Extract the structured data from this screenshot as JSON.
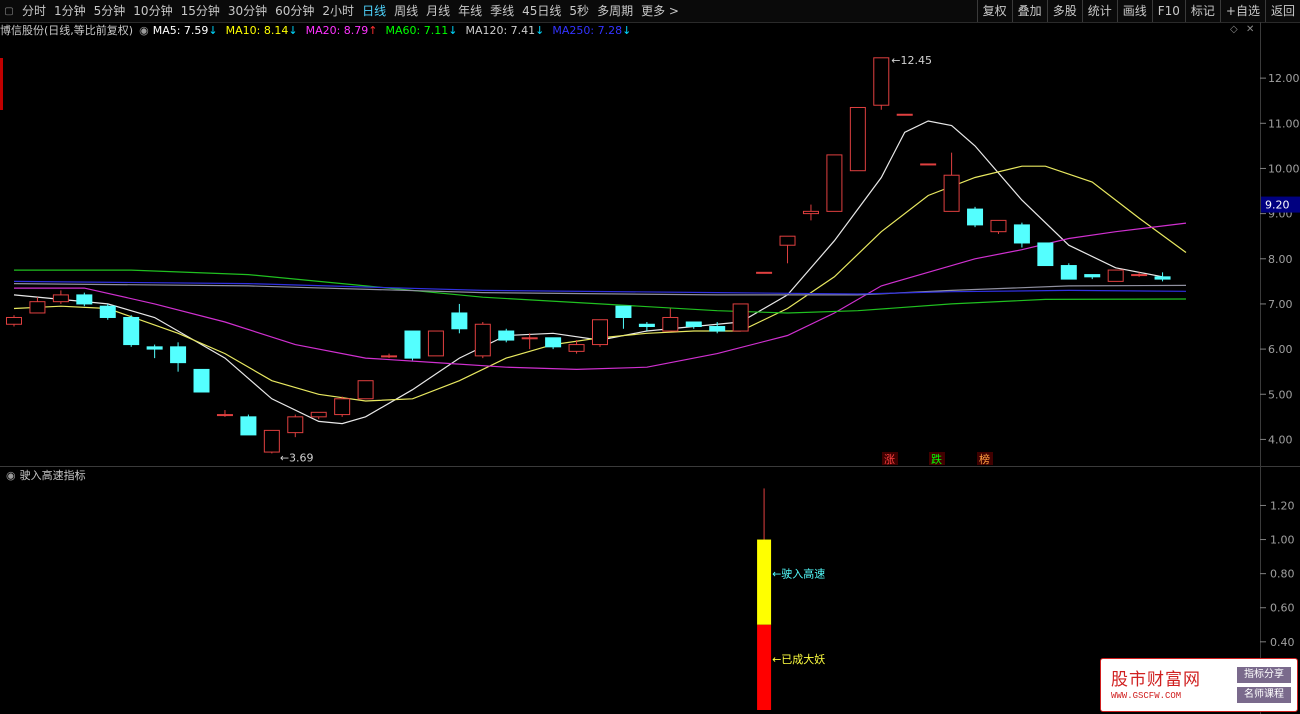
{
  "toolbar": {
    "periods": [
      "分时",
      "1分钟",
      "5分钟",
      "10分钟",
      "15分钟",
      "30分钟",
      "60分钟",
      "2小时",
      "日线",
      "周线",
      "月线",
      "年线",
      "季线",
      "45日线",
      "5秒",
      "多周期",
      "更多 >"
    ],
    "active_period": "日线",
    "right_buttons": [
      "复权",
      "叠加",
      "多股",
      "统计",
      "画线",
      "F10",
      "标记",
      "+自选",
      "返回"
    ]
  },
  "stock": {
    "title": "博信股份(日线,等比前复权)",
    "ma": [
      {
        "label": "MA5: 7.59",
        "arrow": "↓",
        "color": "#ffffff"
      },
      {
        "label": "MA10: 8.14",
        "arrow": "↓",
        "color": "#ffff00"
      },
      {
        "label": "MA20: 8.79",
        "arrow": "↑",
        "color": "#ff33ff"
      },
      {
        "label": "MA60: 7.11",
        "arrow": "↓",
        "color": "#00ff00"
      },
      {
        "label": "MA120: 7.41",
        "arrow": "↓",
        "color": "#cccccc"
      },
      {
        "label": "MA250: 7.28",
        "arrow": "↓",
        "color": "#3333ff"
      }
    ],
    "high_label": "12.45",
    "low_label": "3.69",
    "current_price": "9.20",
    "signals": [
      {
        "text": "涨",
        "color": "#ff4040"
      },
      {
        "text": "跌",
        "color": "#00ff00"
      },
      {
        "text": "榜",
        "color": "#ffa040"
      }
    ],
    "price_ticks": [
      "12.00",
      "11.00",
      "10.00",
      "9.00",
      "8.00",
      "7.00",
      "6.00",
      "5.00",
      "4.00"
    ]
  },
  "indicator": {
    "title": "驶入高速指标",
    "ticks": [
      "1.20",
      "1.00",
      "0.80",
      "0.60",
      "0.40"
    ],
    "label_high": "驶入高速",
    "label_low": "已成大妖"
  },
  "watermark": {
    "title": "股市财富网",
    "url": "WWW.GSCFW.COM",
    "badge1": "指标分享",
    "badge2": "名师课程"
  },
  "chart_data": {
    "type": "candlestick",
    "ylim": [
      3.5,
      12.8
    ],
    "candles": [
      {
        "o": 6.55,
        "h": 6.75,
        "l": 6.5,
        "c": 6.7
      },
      {
        "o": 6.8,
        "h": 7.15,
        "l": 6.8,
        "c": 7.05
      },
      {
        "o": 7.05,
        "h": 7.3,
        "l": 7.0,
        "c": 7.2
      },
      {
        "o": 7.2,
        "h": 7.25,
        "l": 6.95,
        "c": 7.0
      },
      {
        "o": 6.95,
        "h": 7.0,
        "l": 6.65,
        "c": 6.7
      },
      {
        "o": 6.7,
        "h": 6.75,
        "l": 6.05,
        "c": 6.1
      },
      {
        "o": 6.05,
        "h": 6.1,
        "l": 5.8,
        "c": 6.0
      },
      {
        "o": 6.05,
        "h": 6.15,
        "l": 5.5,
        "c": 5.7
      },
      {
        "o": 5.55,
        "h": 5.55,
        "l": 5.05,
        "c": 5.05
      },
      {
        "o": 4.55,
        "h": 4.65,
        "l": 4.5,
        "c": 4.55
      },
      {
        "o": 4.5,
        "h": 4.55,
        "l": 4.1,
        "c": 4.1
      },
      {
        "o": 3.72,
        "h": 4.2,
        "l": 3.69,
        "c": 4.2
      },
      {
        "o": 4.15,
        "h": 4.55,
        "l": 4.05,
        "c": 4.5
      },
      {
        "o": 4.5,
        "h": 4.6,
        "l": 4.45,
        "c": 4.6
      },
      {
        "o": 4.55,
        "h": 4.95,
        "l": 4.5,
        "c": 4.9
      },
      {
        "o": 4.9,
        "h": 5.3,
        "l": 4.9,
        "c": 5.3
      },
      {
        "o": 5.85,
        "h": 5.9,
        "l": 5.8,
        "c": 5.85
      },
      {
        "o": 6.4,
        "h": 6.4,
        "l": 5.75,
        "c": 5.8
      },
      {
        "o": 5.85,
        "h": 6.4,
        "l": 5.85,
        "c": 6.4
      },
      {
        "o": 6.8,
        "h": 7.0,
        "l": 6.35,
        "c": 6.45
      },
      {
        "o": 5.85,
        "h": 6.6,
        "l": 5.8,
        "c": 6.55
      },
      {
        "o": 6.4,
        "h": 6.45,
        "l": 6.15,
        "c": 6.2
      },
      {
        "o": 6.25,
        "h": 6.35,
        "l": 6.0,
        "c": 6.25
      },
      {
        "o": 6.25,
        "h": 6.25,
        "l": 6.0,
        "c": 6.05
      },
      {
        "o": 5.95,
        "h": 6.2,
        "l": 5.9,
        "c": 6.1
      },
      {
        "o": 6.1,
        "h": 6.65,
        "l": 6.05,
        "c": 6.65
      },
      {
        "o": 6.95,
        "h": 6.95,
        "l": 6.45,
        "c": 6.7
      },
      {
        "o": 6.55,
        "h": 6.6,
        "l": 6.4,
        "c": 6.5
      },
      {
        "o": 6.4,
        "h": 6.9,
        "l": 6.4,
        "c": 6.7
      },
      {
        "o": 6.6,
        "h": 6.6,
        "l": 6.45,
        "c": 6.5
      },
      {
        "o": 6.5,
        "h": 6.6,
        "l": 6.35,
        "c": 6.4
      },
      {
        "o": 6.4,
        "h": 7.0,
        "l": 6.4,
        "c": 7.0
      },
      {
        "o": 7.7,
        "h": 7.7,
        "l": 7.7,
        "c": 7.7
      },
      {
        "o": 8.3,
        "h": 8.5,
        "l": 7.9,
        "c": 8.5
      },
      {
        "o": 9.0,
        "h": 9.2,
        "l": 8.85,
        "c": 9.05
      },
      {
        "o": 9.05,
        "h": 10.3,
        "l": 9.05,
        "c": 10.3
      },
      {
        "o": 9.95,
        "h": 11.35,
        "l": 9.95,
        "c": 11.35
      },
      {
        "o": 11.4,
        "h": 12.45,
        "l": 11.3,
        "c": 12.45
      },
      {
        "o": 11.2,
        "h": 11.2,
        "l": 11.2,
        "c": 11.2
      },
      {
        "o": 10.1,
        "h": 10.1,
        "l": 10.1,
        "c": 10.1
      },
      {
        "o": 9.05,
        "h": 10.35,
        "l": 9.05,
        "c": 9.85
      },
      {
        "o": 9.1,
        "h": 9.15,
        "l": 8.7,
        "c": 8.75
      },
      {
        "o": 8.6,
        "h": 8.85,
        "l": 8.55,
        "c": 8.85
      },
      {
        "o": 8.75,
        "h": 8.8,
        "l": 8.25,
        "c": 8.35
      },
      {
        "o": 8.35,
        "h": 8.35,
        "l": 7.85,
        "c": 7.85
      },
      {
        "o": 7.85,
        "h": 7.9,
        "l": 7.55,
        "c": 7.55
      },
      {
        "o": 7.65,
        "h": 7.65,
        "l": 7.55,
        "c": 7.6
      },
      {
        "o": 7.5,
        "h": 7.75,
        "l": 7.5,
        "c": 7.75
      },
      {
        "o": 7.65,
        "h": 7.7,
        "l": 7.6,
        "c": 7.65
      },
      {
        "o": 7.6,
        "h": 7.7,
        "l": 7.5,
        "c": 7.55
      }
    ],
    "ma_lines": {
      "ma5": [
        [
          0,
          7.2
        ],
        [
          4,
          7.0
        ],
        [
          6,
          6.7
        ],
        [
          9,
          5.8
        ],
        [
          11,
          4.9
        ],
        [
          13,
          4.4
        ],
        [
          14,
          4.35
        ],
        [
          15,
          4.5
        ],
        [
          17,
          5.1
        ],
        [
          19,
          5.8
        ],
        [
          21,
          6.3
        ],
        [
          23,
          6.35
        ],
        [
          25,
          6.2
        ],
        [
          27,
          6.4
        ],
        [
          29,
          6.5
        ],
        [
          31,
          6.6
        ],
        [
          33,
          7.2
        ],
        [
          35,
          8.4
        ],
        [
          37,
          9.8
        ],
        [
          38,
          10.8
        ],
        [
          39,
          11.05
        ],
        [
          40,
          10.95
        ],
        [
          41,
          10.5
        ],
        [
          43,
          9.3
        ],
        [
          45,
          8.3
        ],
        [
          47,
          7.8
        ],
        [
          49,
          7.6
        ]
      ],
      "ma10": [
        [
          0,
          6.9
        ],
        [
          2,
          6.95
        ],
        [
          4,
          6.9
        ],
        [
          7,
          6.35
        ],
        [
          9,
          5.9
        ],
        [
          11,
          5.3
        ],
        [
          13,
          5.0
        ],
        [
          15,
          4.85
        ],
        [
          17,
          4.9
        ],
        [
          19,
          5.3
        ],
        [
          21,
          5.8
        ],
        [
          23,
          6.1
        ],
        [
          25,
          6.25
        ],
        [
          27,
          6.35
        ],
        [
          29,
          6.4
        ],
        [
          31,
          6.4
        ],
        [
          33,
          6.9
        ],
        [
          35,
          7.6
        ],
        [
          37,
          8.6
        ],
        [
          39,
          9.4
        ],
        [
          41,
          9.8
        ],
        [
          43,
          10.05
        ],
        [
          44,
          10.05
        ],
        [
          46,
          9.7
        ],
        [
          48,
          8.9
        ],
        [
          50,
          8.14
        ]
      ],
      "ma20": [
        [
          0,
          7.35
        ],
        [
          3,
          7.35
        ],
        [
          6,
          7.0
        ],
        [
          9,
          6.6
        ],
        [
          12,
          6.1
        ],
        [
          15,
          5.8
        ],
        [
          18,
          5.7
        ],
        [
          21,
          5.6
        ],
        [
          24,
          5.55
        ],
        [
          27,
          5.6
        ],
        [
          30,
          5.9
        ],
        [
          33,
          6.3
        ],
        [
          35,
          6.8
        ],
        [
          37,
          7.4
        ],
        [
          39,
          7.7
        ],
        [
          41,
          8.0
        ],
        [
          43,
          8.2
        ],
        [
          45,
          8.45
        ],
        [
          47,
          8.6
        ],
        [
          50,
          8.79
        ]
      ],
      "ma60": [
        [
          0,
          7.75
        ],
        [
          5,
          7.75
        ],
        [
          10,
          7.65
        ],
        [
          15,
          7.4
        ],
        [
          20,
          7.15
        ],
        [
          25,
          7.0
        ],
        [
          30,
          6.85
        ],
        [
          33,
          6.8
        ],
        [
          36,
          6.85
        ],
        [
          40,
          7.0
        ],
        [
          44,
          7.1
        ],
        [
          50,
          7.11
        ]
      ],
      "ma120": [
        [
          0,
          7.45
        ],
        [
          10,
          7.4
        ],
        [
          20,
          7.25
        ],
        [
          30,
          7.2
        ],
        [
          36,
          7.2
        ],
        [
          40,
          7.3
        ],
        [
          45,
          7.4
        ],
        [
          50,
          7.41
        ]
      ],
      "ma250": [
        [
          0,
          7.5
        ],
        [
          10,
          7.45
        ],
        [
          20,
          7.3
        ],
        [
          30,
          7.25
        ],
        [
          36,
          7.22
        ],
        [
          40,
          7.27
        ],
        [
          45,
          7.3
        ],
        [
          50,
          7.28
        ]
      ]
    },
    "indicator_bar": {
      "index": 32,
      "yellow": [
        0.5,
        1.0
      ],
      "red": [
        0.0,
        0.5
      ],
      "wick_top": 1.3
    }
  }
}
